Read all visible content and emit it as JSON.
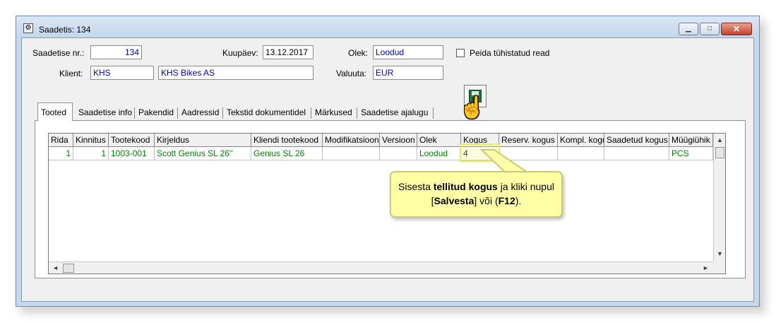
{
  "window": {
    "title": "Saadetis: 134",
    "icon": "window-app-icon",
    "controls": {
      "minimize": "▁",
      "maximize": "□",
      "close": "✕"
    }
  },
  "form": {
    "shipment_no_label": "Saadetise nr.:",
    "shipment_no_value": "134",
    "date_label": "Kuupäev:",
    "date_value": "13.12.2017",
    "status_label": "Olek:",
    "status_value": "Loodud",
    "hide_deleted_label": "Peida tühistatud read",
    "hide_deleted_checked": false,
    "client_label": "Klient:",
    "client_code": "KHS",
    "client_name": "KHS Bikes AS",
    "currency_label": "Valuuta:",
    "currency_value": "EUR"
  },
  "tabs": [
    {
      "label": "Tooted",
      "active": true
    },
    {
      "label": "Saadetise info",
      "active": false
    },
    {
      "label": "Pakendid",
      "active": false
    },
    {
      "label": "Aadressid",
      "active": false
    },
    {
      "label": "Tekstid dokumentidel",
      "active": false
    },
    {
      "label": "Märkused",
      "active": false
    },
    {
      "label": "Saadetise ajalugu",
      "active": false
    }
  ],
  "grid": {
    "columns": [
      "Rida",
      "Kinnitus",
      "Tootekood",
      "Kirjeldus",
      "Kliendi tootekood",
      "Modifikatsioon",
      "Versioon",
      "Olek",
      "Kogus",
      "Reserv. kogus",
      "Kompl. kogus",
      "Saadetud kogus",
      "Müügiühik"
    ],
    "rows": [
      {
        "rida": "1",
        "kinnitus": "1",
        "tootekood": "1003-001",
        "kirjeldus": "Scott Genius SL 26''",
        "kliendi_tootekood": "Genius SL 26",
        "modifikatsioon": "",
        "versioon": "",
        "olek": "Loodud",
        "kogus": "4",
        "reserv_kogus": "",
        "kompl_kogus": "",
        "saadetud_kogus": "",
        "myygiyhik": "PCS"
      }
    ],
    "row_text_color": "#008000"
  },
  "toolbar": {
    "save_icon": "save-disk-icon",
    "cursor_icon": "hand-pointer-icon"
  },
  "callout": {
    "part1": "Sisesta ",
    "bold1": "tellitud kogus",
    "part2": " ja kliki nupul [",
    "bold2": "Salvesta",
    "part3": "] või (",
    "bold3": "F12",
    "part4": ")."
  }
}
